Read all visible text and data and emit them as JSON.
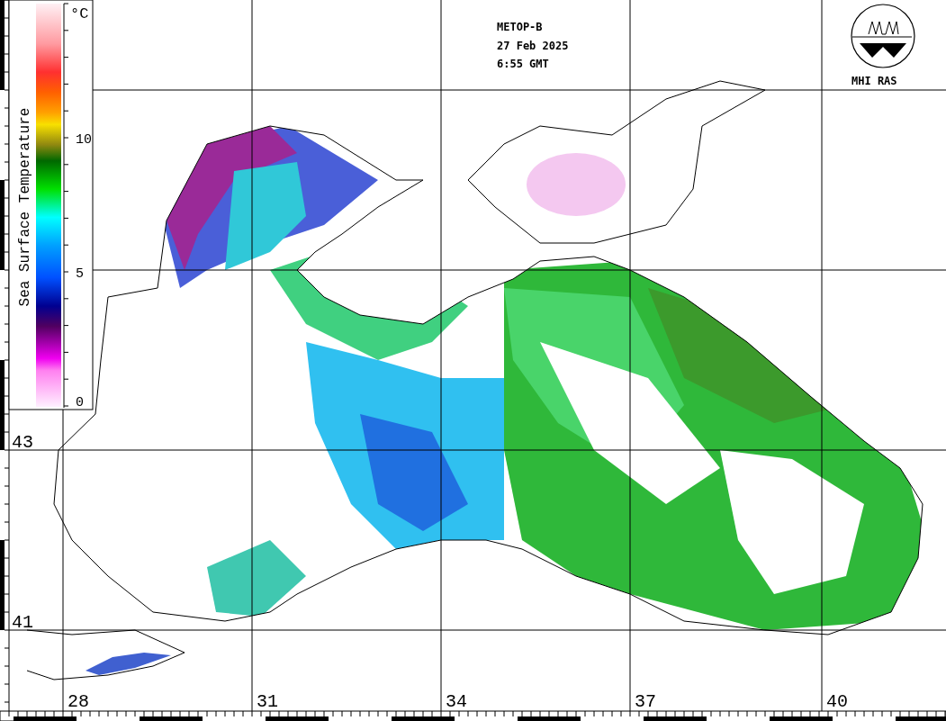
{
  "header": {
    "satellite": "METOP-B",
    "date": "27 Feb 2025",
    "time": "6:55 GMT"
  },
  "logo": {
    "caption": "MHI RAS"
  },
  "legend": {
    "title": "Sea Surface Temperature",
    "unit": "°C",
    "tick_labels": [
      "10",
      "5",
      "0"
    ]
  },
  "grid": {
    "latitudes": [
      "43",
      "41"
    ],
    "longitudes": [
      "28",
      "31",
      "34",
      "37",
      "40"
    ]
  }
}
